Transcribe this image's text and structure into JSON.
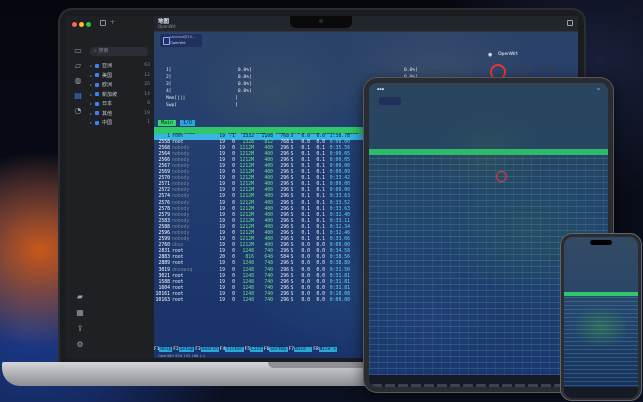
{
  "window": {
    "title": "地图",
    "subtitle": "OpenWrt"
  },
  "ssh_card": {
    "line1": "ssh/root@10...",
    "line2": "OpenWrt"
  },
  "operator": {
    "label": "OpenWrt"
  },
  "sidebar": {
    "search_placeholder": "搜索",
    "regions": [
      {
        "name": "亚洲",
        "count": "63"
      },
      {
        "name": "美国",
        "count": "12"
      },
      {
        "name": "欧洲",
        "count": "20"
      },
      {
        "name": "新加坡",
        "count": "14"
      },
      {
        "name": "日本",
        "count": "8"
      },
      {
        "name": "其他",
        "count": "19"
      },
      {
        "name": "中国",
        "count": "1"
      }
    ]
  },
  "cpu_meters": [
    "1[                        0.0%]",
    "2[                        0.0%]",
    "3[                        0.0%]",
    "4[                        0.0%]",
    "Mem[|||                  ]",
    "Swp[                     ]"
  ],
  "cpu_meters_right": [
    "0.0%]",
    "0.0%]",
    "0.0%]",
    "0.0%]",
    "1 day,"
  ],
  "htop": {
    "tab_main": "Main",
    "tab_io": "I/O",
    "columns": [
      "PID",
      "USER",
      "PRI",
      "NI",
      "VIRT",
      "RES",
      "SHR",
      "S",
      "CPU%",
      "MEM%",
      "TIME+"
    ],
    "rows": [
      [
        "1",
        "root",
        "19",
        "-1",
        "1332",
        "1108",
        "768",
        "S",
        "0.0",
        "0.0",
        "1:38.78",
        "sel"
      ],
      [
        "2558",
        "root",
        "19",
        "0",
        "1328",
        "812",
        "768",
        "S",
        "0.0",
        "0.0",
        "0:00.00",
        ""
      ],
      [
        "2568",
        "nobody",
        "19",
        "0",
        "1212M",
        "400",
        "296",
        "S",
        "0.1",
        "0.1",
        "0:35.56",
        "gray"
      ],
      [
        "2564",
        "nobody",
        "19",
        "0",
        "1212M",
        "400",
        "296",
        "S",
        "0.1",
        "0.1",
        "0:00.05",
        "gray"
      ],
      [
        "2566",
        "nobody",
        "19",
        "0",
        "1212M",
        "400",
        "296",
        "S",
        "0.1",
        "0.1",
        "0:00.05",
        "gray"
      ],
      [
        "2567",
        "nobody",
        "19",
        "0",
        "1212M",
        "400",
        "296",
        "S",
        "0.1",
        "0.1",
        "0:00.00",
        "gray"
      ],
      [
        "2569",
        "nobody",
        "19",
        "0",
        "1212M",
        "400",
        "296",
        "S",
        "0.1",
        "0.1",
        "0:00.09",
        "gray"
      ],
      [
        "2570",
        "nobody",
        "19",
        "0",
        "1212M",
        "400",
        "296",
        "S",
        "0.1",
        "0.1",
        "0:33.42",
        "gray"
      ],
      [
        "2571",
        "nobody",
        "19",
        "0",
        "1212M",
        "400",
        "296",
        "S",
        "0.1",
        "0.1",
        "0:00.00",
        "gray"
      ],
      [
        "2572",
        "nobody",
        "19",
        "0",
        "1212M",
        "400",
        "296",
        "S",
        "0.1",
        "0.1",
        "0:00.00",
        "gray"
      ],
      [
        "2574",
        "nobody",
        "19",
        "0",
        "1212M",
        "400",
        "296",
        "S",
        "0.1",
        "0.1",
        "0:33.63",
        "gray"
      ],
      [
        "2576",
        "nobody",
        "19",
        "0",
        "1212M",
        "400",
        "296",
        "S",
        "0.1",
        "0.1",
        "0:33.52",
        "gray"
      ],
      [
        "2578",
        "nobody",
        "19",
        "0",
        "1212M",
        "400",
        "296",
        "S",
        "0.1",
        "0.1",
        "0:33.63",
        "gray"
      ],
      [
        "2579",
        "nobody",
        "19",
        "0",
        "1212M",
        "400",
        "296",
        "S",
        "0.1",
        "0.1",
        "0:32.40",
        "gray"
      ],
      [
        "2583",
        "nobody",
        "19",
        "0",
        "1212M",
        "400",
        "296",
        "S",
        "0.1",
        "0.1",
        "0:33.11",
        "gray"
      ],
      [
        "2588",
        "nobody",
        "19",
        "0",
        "1212M",
        "400",
        "296",
        "S",
        "0.1",
        "0.1",
        "0:32.34",
        "gray"
      ],
      [
        "2596",
        "nobody",
        "19",
        "0",
        "1212M",
        "400",
        "296",
        "S",
        "0.1",
        "0.1",
        "0:32.46",
        "gray"
      ],
      [
        "2599",
        "nobody",
        "19",
        "0",
        "1212M",
        "400",
        "296",
        "S",
        "0.1",
        "0.1",
        "0:33.66",
        "gray"
      ],
      [
        "2760",
        "ubus",
        "19",
        "0",
        "1212M",
        "400",
        "296",
        "S",
        "0.0",
        "0.0",
        "0:00.00",
        "gray"
      ],
      [
        "2831",
        "root",
        "19",
        "0",
        "1248",
        "740",
        "296",
        "S",
        "0.0",
        "0.0",
        "0:34.58",
        ""
      ],
      [
        "2883",
        "root",
        "20",
        "0",
        "816",
        "648",
        "584",
        "S",
        "0.0",
        "0.0",
        "0:38.56",
        ""
      ],
      [
        "2889",
        "root",
        "19",
        "0",
        "1248",
        "748",
        "296",
        "S",
        "0.0",
        "0.0",
        "0:38.89",
        ""
      ],
      [
        "3019",
        "dnsmasq",
        "19",
        "0",
        "1248",
        "740",
        "296",
        "S",
        "0.0",
        "0.0",
        "0:31.50",
        "gray"
      ],
      [
        "3021",
        "root",
        "19",
        "0",
        "1248",
        "740",
        "296",
        "S",
        "0.0",
        "0.0",
        "0:31.81",
        ""
      ],
      [
        "1588",
        "root",
        "19",
        "0",
        "1248",
        "740",
        "296",
        "S",
        "0.0",
        "0.0",
        "0:31.81",
        ""
      ],
      [
        "1604",
        "root",
        "19",
        "0",
        "1248",
        "740",
        "296",
        "S",
        "0.0",
        "0.0",
        "0:31.81",
        ""
      ],
      [
        "10161",
        "root",
        "19",
        "0",
        "1248",
        "740",
        "296",
        "S",
        "0.0",
        "0.0",
        "0:10.08",
        ""
      ],
      [
        "10163",
        "root",
        "19",
        "0",
        "1248",
        "740",
        "296",
        "S",
        "0.0",
        "0.0",
        "0:00.00",
        ""
      ]
    ],
    "fkeys": [
      {
        "num": "F1",
        "label": "Help"
      },
      {
        "num": "F2",
        "label": "Setup"
      },
      {
        "num": "F3",
        "label": "Search"
      },
      {
        "num": "F4",
        "label": "Filter"
      },
      {
        "num": "F5",
        "label": "List"
      },
      {
        "num": "F6",
        "label": "SortBy"
      },
      {
        "num": "F7",
        "label": "Nice -"
      },
      {
        "num": "F8",
        "label": "Nice +"
      }
    ],
    "statusline": "OpenWrt SSH 192.168.1.1"
  },
  "colors": {
    "htop_green": "#2fc76a",
    "htop_cyan": "#37b3e6",
    "accent_blue": "#3b82f6",
    "alert_red": "#e53935"
  }
}
